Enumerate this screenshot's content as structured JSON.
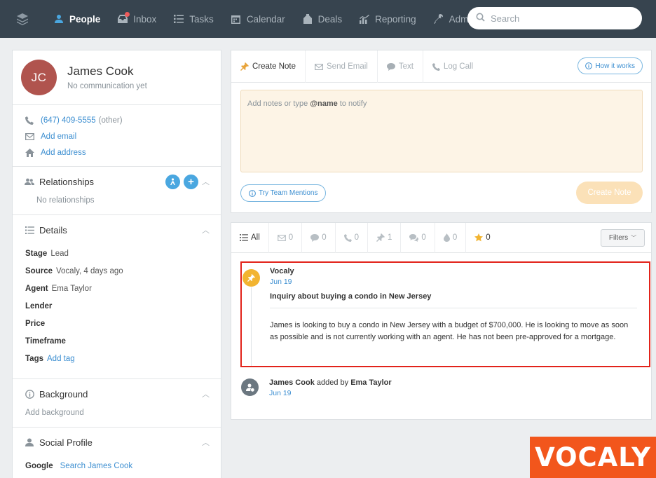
{
  "nav": {
    "items": [
      {
        "label": "People",
        "icon": "person-icon",
        "active": true
      },
      {
        "label": "Inbox",
        "icon": "inbox-icon",
        "active": false
      },
      {
        "label": "Tasks",
        "icon": "tasks-icon",
        "active": false
      },
      {
        "label": "Calendar",
        "icon": "calendar-icon",
        "active": false
      },
      {
        "label": "Deals",
        "icon": "deals-icon",
        "active": false
      },
      {
        "label": "Reporting",
        "icon": "reporting-icon",
        "active": false
      },
      {
        "label": "Admin",
        "icon": "wrench-icon",
        "active": false
      }
    ],
    "search_placeholder": "Search"
  },
  "profile": {
    "initials": "JC",
    "name": "James Cook",
    "subtitle": "No communication yet",
    "avatar_color": "#b0544e"
  },
  "contact": {
    "phone": "(647) 409-5555",
    "phone_type": "(other)",
    "add_email": "Add email",
    "add_address": "Add address"
  },
  "relationships": {
    "title": "Relationships",
    "empty": "No relationships"
  },
  "details": {
    "title": "Details",
    "rows": [
      {
        "label": "Stage",
        "value": "Lead",
        "is_link": false
      },
      {
        "label": "Source",
        "value": "Vocaly, 4 days ago",
        "is_link": false
      },
      {
        "label": "Agent",
        "value": "Ema Taylor",
        "is_link": false
      },
      {
        "label": "Lender",
        "value": "",
        "is_link": false
      },
      {
        "label": "Price",
        "value": "",
        "is_link": false
      },
      {
        "label": "Timeframe",
        "value": "",
        "is_link": false
      },
      {
        "label": "Tags",
        "value": "Add tag",
        "is_link": true
      }
    ]
  },
  "background": {
    "title": "Background",
    "placeholder": "Add background"
  },
  "social": {
    "title": "Social Profile",
    "row_label": "Google",
    "row_value": "Search James Cook"
  },
  "composer": {
    "tabs": [
      {
        "label": "Create Note",
        "icon": "pin-icon",
        "active": true
      },
      {
        "label": "Send Email",
        "icon": "email-icon",
        "active": false
      },
      {
        "label": "Text",
        "icon": "chat-icon",
        "active": false
      },
      {
        "label": "Log Call",
        "icon": "phone-icon",
        "active": false
      }
    ],
    "how_it_works": "How it works",
    "placeholder_pre": "Add notes or type ",
    "placeholder_mention": "@name",
    "placeholder_post": " to notify",
    "team_mentions": "Try Team Mentions",
    "create_button": "Create Note"
  },
  "timeline": {
    "filters": [
      {
        "label": "All",
        "icon": "list-icon",
        "active": true
      },
      {
        "label": "0",
        "icon": "email-icon",
        "active": false
      },
      {
        "label": "0",
        "icon": "chat-icon",
        "active": false
      },
      {
        "label": "0",
        "icon": "phone-icon",
        "active": false
      },
      {
        "label": "1",
        "icon": "pin-icon",
        "active": false
      },
      {
        "label": "0",
        "icon": "chat-bubbles-icon",
        "active": false
      },
      {
        "label": "0",
        "icon": "drop-icon",
        "active": false
      },
      {
        "label": "0",
        "icon": "star-icon",
        "active": false
      }
    ],
    "filters_button": "Filters",
    "entry": {
      "source": "Vocaly",
      "date": "Jun 19",
      "title": "Inquiry about buying a condo in New Jersey",
      "body": "James is looking to buy a condo in New Jersey with a budget of $700,000. He is looking to move as soon as possible and is not currently working with an agent. He has not been pre-approved for a mortgage."
    },
    "added": {
      "person": "James Cook",
      "middle": " added by ",
      "by": "Ema Taylor",
      "date": "Jun 19"
    }
  },
  "watermark": "VOCALY",
  "colors": {
    "nav_bg": "#37444f",
    "accent_blue": "#4aa7e0",
    "note_bg": "#fdf4e6",
    "highlight_red": "#e2231a",
    "watermark_orange": "#f2561c"
  }
}
